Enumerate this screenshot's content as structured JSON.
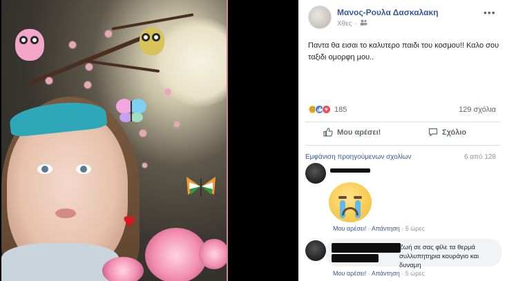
{
  "post": {
    "author": "Μανος-Ρουλα Δασκαλακη",
    "time": "Χθες",
    "audience_icon": "friends-icon",
    "more_label": "•••",
    "text": "Παντα θα εισαι το καλυτερο παιδι του κοσμου!! Καλο σου ταξιδι ομορφη μου..",
    "reactions": {
      "icons": [
        "sad-icon",
        "like-icon",
        "love-icon"
      ],
      "count": "185"
    },
    "comments_count": "129 σχόλια"
  },
  "actions": {
    "like_label": "Μου αρέσει!",
    "comment_label": "Σχόλιο"
  },
  "comments_section": {
    "prev_label": "Εμφάνιση προηγούμενων σχολίων",
    "pager": "6 από 128",
    "comments": [
      {
        "content": "crying-emoji",
        "like": "Μου αρέσει!",
        "sep1": " · ",
        "reply": "Απάντηση",
        "sep2": " · ",
        "time": "5 ώρες"
      },
      {
        "text": "Ζωή σε σας φίλε τα θερμά συλλυπητηρια κουράγιο και δυναμη",
        "like": "Μου αρέσει!",
        "sep1": " · ",
        "reply": "Απάντηση",
        "sep2": " · ",
        "time": "5 ώρες"
      }
    ]
  },
  "colors": {
    "link": "#365899",
    "muted": "#90949c",
    "photo_border": "#c98aa0"
  }
}
